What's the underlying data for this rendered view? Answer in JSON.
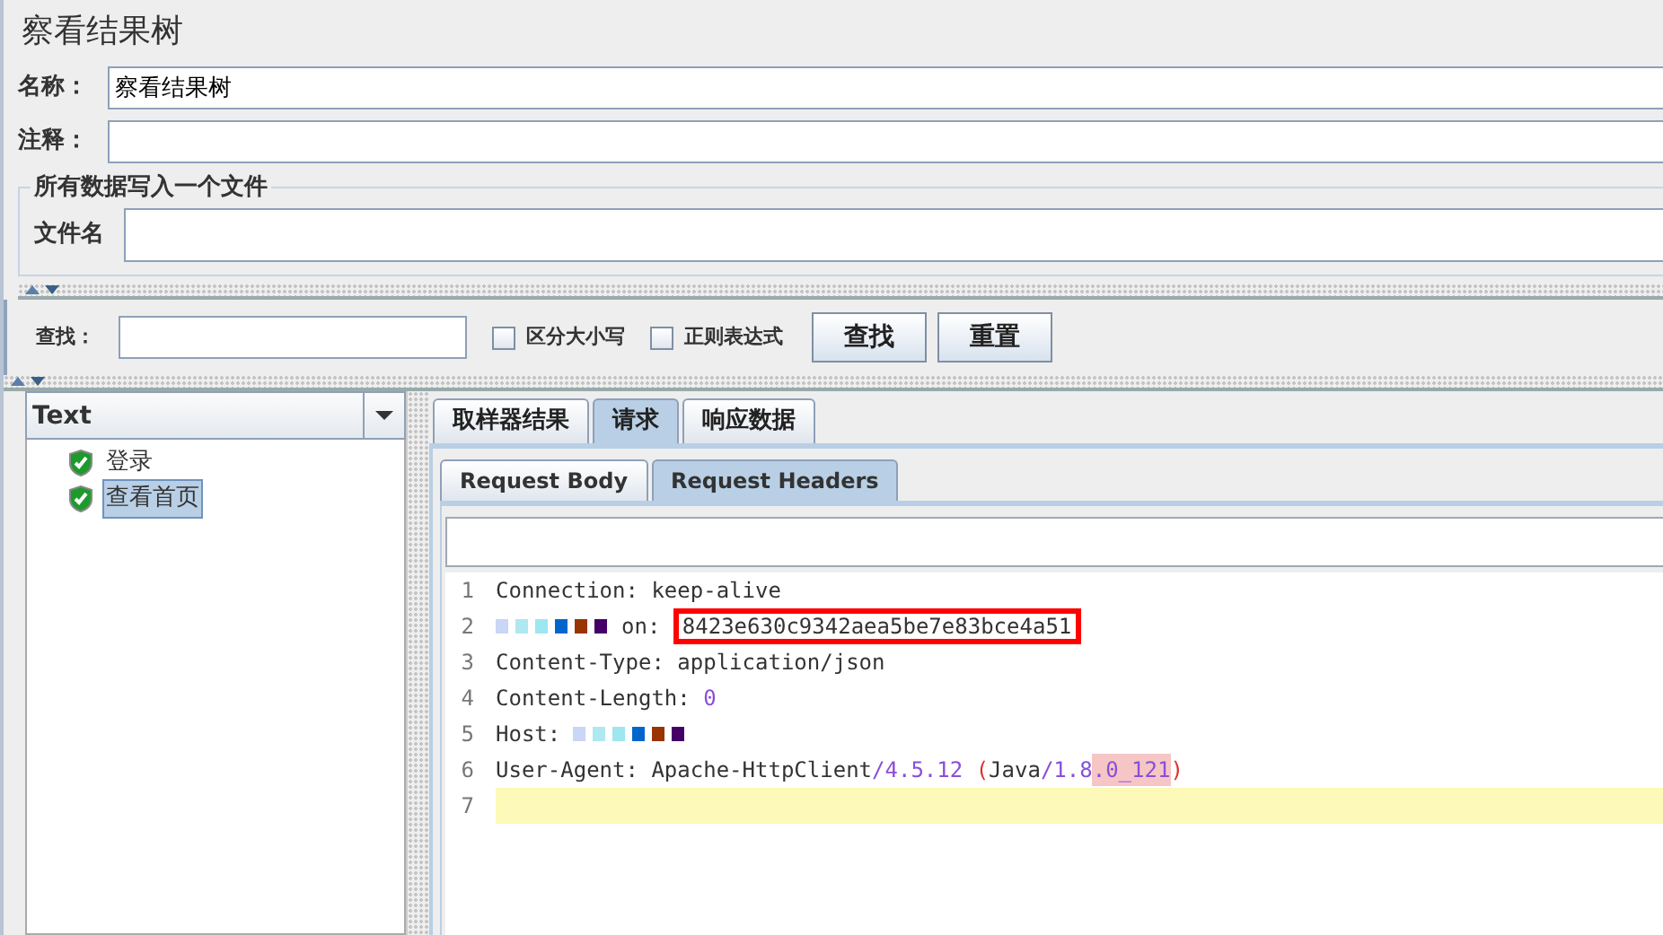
{
  "title": "察看结果树",
  "fields": [
    {
      "label": "名称：",
      "value": "察看结果树"
    },
    {
      "label": "注释："
    }
  ],
  "file_group": {
    "legend": "所有数据写入一个文件",
    "label": "文件名"
  },
  "search": {
    "label": "查找：",
    "options": [
      {
        "label": "区分大小写",
        "checked": false
      },
      {
        "label": "正则表达式",
        "checked": false
      }
    ],
    "buttons": [
      "查找",
      "重置"
    ]
  },
  "renderer": {
    "value": "Text"
  },
  "tree": [
    {
      "label": "登录",
      "selected": false
    },
    {
      "label": "查看首页",
      "selected": true
    }
  ],
  "tabs": [
    {
      "label": "取样器结果",
      "selected": false
    },
    {
      "label": "请求",
      "selected": true
    },
    {
      "label": "响应数据",
      "selected": false
    }
  ],
  "subtabs": [
    {
      "label": "Request Body",
      "selected": false
    },
    {
      "label": "Request Headers",
      "selected": true
    }
  ],
  "code_lines": [
    {
      "number": "1",
      "current": false,
      "tokens": [
        {
          "kind": "plain",
          "text": "Connection: keep-alive"
        }
      ]
    },
    {
      "number": "2",
      "current": false,
      "tokens": [
        {
          "kind": "redacted"
        },
        {
          "kind": "plain",
          "text": "on: "
        },
        {
          "kind": "boxed",
          "text": "8423e630c9342aea5be7e83bce4a51"
        }
      ]
    },
    {
      "number": "3",
      "current": false,
      "tokens": [
        {
          "kind": "plain",
          "text": "Content-Type: application/json"
        }
      ]
    },
    {
      "number": "4",
      "current": false,
      "tokens": [
        {
          "kind": "plain",
          "text": "Content-Length: "
        },
        {
          "kind": "number",
          "text": "0"
        }
      ]
    },
    {
      "number": "5",
      "current": false,
      "tokens": [
        {
          "kind": "plain",
          "text": "Host: "
        },
        {
          "kind": "redacted"
        }
      ]
    },
    {
      "number": "6",
      "current": false,
      "tokens": [
        {
          "kind": "plain",
          "text": "User-Agent: Apache-HttpClient"
        },
        {
          "kind": "number",
          "text": "/4.5.12"
        },
        {
          "kind": "paren",
          "text": " ("
        },
        {
          "kind": "plain",
          "text": "Java"
        },
        {
          "kind": "number",
          "text": "/1.8"
        },
        {
          "kind": "marked",
          "text": ".0_121"
        },
        {
          "kind": "paren",
          "text": ")"
        }
      ]
    },
    {
      "number": "7",
      "current": true
    }
  ]
}
